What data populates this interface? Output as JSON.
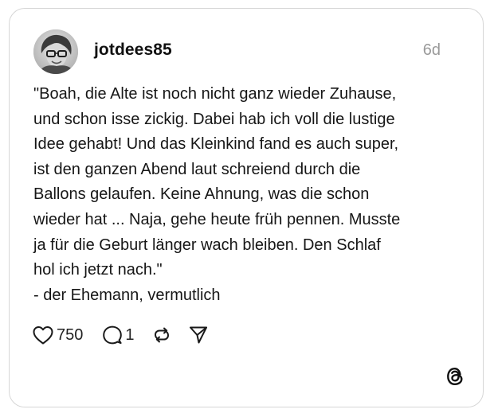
{
  "post": {
    "username": "jotdees85",
    "timestamp": "6d",
    "text": "\"Boah, die Alte ist noch nicht ganz wieder Zuhause,\nund schon isse zickig. Dabei hab ich voll die lustige\nIdee gehabt! Und das Kleinkind fand es auch super,\nist den ganzen Abend laut schreiend durch die\nBallons gelaufen. Keine Ahnung, was die schon\nwieder hat ... Naja, gehe heute früh pennen. Musste\nja für die Geburt länger wach bleiben. Den Schlaf\nhol ich jetzt nach.\"\n- der Ehemann, vermutlich",
    "likes": "750",
    "replies": "1"
  },
  "icons": {
    "like": "heart-icon",
    "reply": "comment-bubble-icon",
    "repost": "repost-icon",
    "share": "send-icon",
    "brand": "threads-logo-icon"
  },
  "colors": {
    "text": "#161616",
    "muted": "#9a9a9a",
    "border": "#d6d6d6"
  }
}
